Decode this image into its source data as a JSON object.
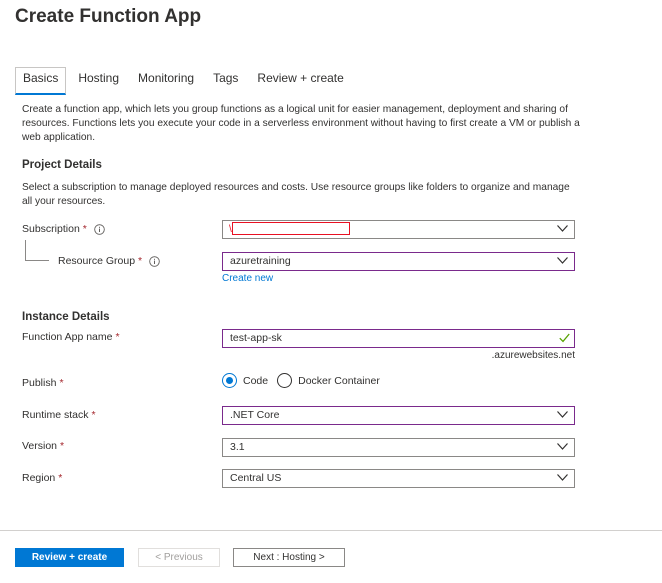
{
  "page": {
    "title": "Create Function App"
  },
  "tabs": [
    {
      "label": "Basics",
      "active": true
    },
    {
      "label": "Hosting"
    },
    {
      "label": "Monitoring"
    },
    {
      "label": "Tags"
    },
    {
      "label": "Review + create"
    }
  ],
  "intro": "Create a function app, which lets you group functions as a logical unit for easier management, deployment and sharing of resources. Functions lets you execute your code in a serverless environment without having to first create a VM or publish a web application.",
  "project": {
    "title": "Project Details",
    "description": "Select a subscription to manage deployed resources and costs. Use resource groups like folders to organize and manage all your resources.",
    "subscription": {
      "label": "Subscription",
      "value": ""
    },
    "resource_group": {
      "label": "Resource Group",
      "value": "azuretraining",
      "create_new": "Create new"
    }
  },
  "instance": {
    "title": "Instance Details",
    "app_name": {
      "label": "Function App name",
      "value": "test-app-sk",
      "suffix": ".azurewebsites.net"
    },
    "publish": {
      "label": "Publish",
      "options": [
        "Code",
        "Docker Container"
      ],
      "selected": "Code"
    },
    "runtime": {
      "label": "Runtime stack",
      "value": ".NET Core"
    },
    "version": {
      "label": "Version",
      "value": "3.1"
    },
    "region": {
      "label": "Region",
      "value": "Central US"
    }
  },
  "required_mark": "*",
  "footer": {
    "review_create": "Review + create",
    "previous": "< Previous",
    "next": "Next : Hosting >"
  },
  "colors": {
    "accent": "#0078d4",
    "required": "#a4262c",
    "focus_border": "#7a2a8c",
    "valid_check": "#57a300"
  }
}
